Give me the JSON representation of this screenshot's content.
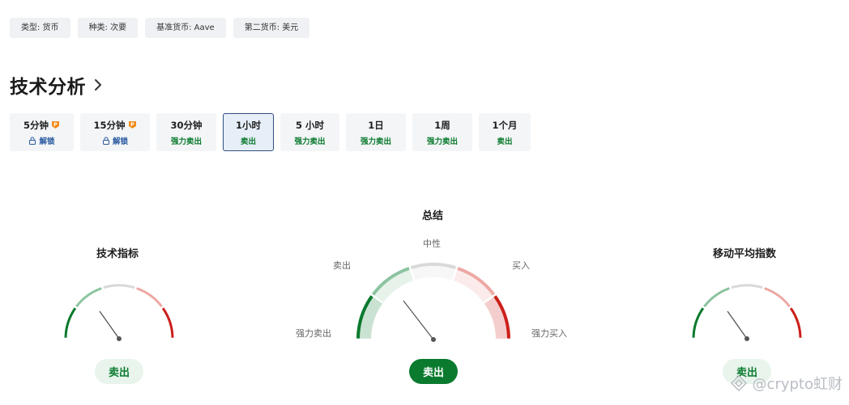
{
  "tags": [
    {
      "label": "类型: 货币"
    },
    {
      "label": "种类: 次要"
    },
    {
      "label": "基准货币: Aave"
    },
    {
      "label": "第二货币: 美元"
    }
  ],
  "section": {
    "title": "技术分析"
  },
  "timeframes": [
    {
      "label": "5分钟",
      "signal": "解锁",
      "locked": true,
      "active": false
    },
    {
      "label": "15分钟",
      "signal": "解锁",
      "locked": true,
      "active": false
    },
    {
      "label": "30分钟",
      "signal": "强力卖出",
      "locked": false,
      "active": false
    },
    {
      "label": "1小时",
      "signal": "卖出",
      "locked": false,
      "active": true
    },
    {
      "label": "5 小时",
      "signal": "强力卖出",
      "locked": false,
      "active": false
    },
    {
      "label": "1日",
      "signal": "强力卖出",
      "locked": false,
      "active": false
    },
    {
      "label": "1周",
      "signal": "强力卖出",
      "locked": false,
      "active": false
    },
    {
      "label": "1个月",
      "signal": "卖出",
      "locked": false,
      "active": false
    }
  ],
  "gauges": {
    "indicators": {
      "title": "技术指标",
      "result": "卖出"
    },
    "summary": {
      "title": "总结",
      "result": "卖出",
      "labels": {
        "strong_sell": "强力卖出",
        "sell": "卖出",
        "neutral": "中性",
        "buy": "买入",
        "strong_buy": "强力买入"
      }
    },
    "moving_averages": {
      "title": "移动平均指数",
      "result": "卖出"
    }
  },
  "colors": {
    "strong_sell": "#0a7a2e",
    "sell": "#8cc4a0",
    "neutral": "#d9d9d9",
    "buy": "#eda8a3",
    "strong_buy": "#cc1f1a",
    "needle": "#555555"
  },
  "watermark": {
    "text": "@crypto虹财"
  }
}
